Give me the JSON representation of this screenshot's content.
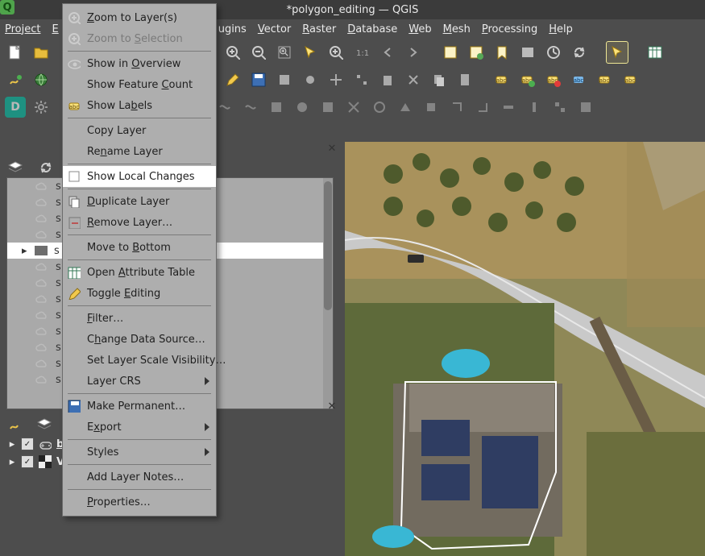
{
  "window": {
    "title": "*polygon_editing — QGIS"
  },
  "menubar": {
    "project": "Project",
    "edit_partial": "E",
    "plugins_partial": "ugins",
    "vector": "Vector",
    "raster": "Raster",
    "database": "Database",
    "web": "Web",
    "mesh": "Mesh",
    "processing": "Processing",
    "help": "Help"
  },
  "context_menu": {
    "zoom_to_layers": "Zoom to Layer(s)",
    "zoom_to_selection": "Zoom to Selection",
    "show_in_overview": "Show in Overview",
    "show_feature_count": "Show Feature Count",
    "show_labels": "Show Labels",
    "copy_layer": "Copy Layer",
    "rename_layer": "Rename Layer",
    "show_local_changes": "Show Local Changes",
    "duplicate_layer": "Duplicate Layer",
    "remove_layer": "Remove Layer…",
    "move_to_bottom": "Move to Bottom",
    "open_attribute_table": "Open Attribute Table",
    "toggle_editing": "Toggle Editing",
    "filter": "Filter…",
    "change_data_source": "Change Data Source…",
    "set_layer_scale_visibility": "Set Layer Scale Visibility…",
    "layer_crs": "Layer CRS",
    "make_permanent": "Make Permanent…",
    "export": "Export",
    "styles": "Styles",
    "add_layer_notes": "Add Layer Notes…",
    "properties": "Properties…"
  },
  "layers_tree": {
    "rows": [
      {
        "type": "cloud",
        "label": "s"
      },
      {
        "type": "cloud",
        "label": "s"
      },
      {
        "type": "cloud",
        "label": "s"
      },
      {
        "type": "cloud",
        "label": "s"
      },
      {
        "type": "folder",
        "label": "s",
        "selected": true
      },
      {
        "type": "cloud",
        "label": "s"
      },
      {
        "type": "cloud",
        "label": "s"
      },
      {
        "type": "cloud",
        "label": "s"
      },
      {
        "type": "cloud",
        "label": "s"
      },
      {
        "type": "cloud",
        "label": "s"
      },
      {
        "type": "cloud",
        "label": "s"
      },
      {
        "type": "cloud",
        "label": "s"
      },
      {
        "type": "cloud",
        "label": "s"
      }
    ]
  },
  "layers_panel2": {
    "buildings_label_partial": "bu",
    "second_label_partial": "V"
  }
}
